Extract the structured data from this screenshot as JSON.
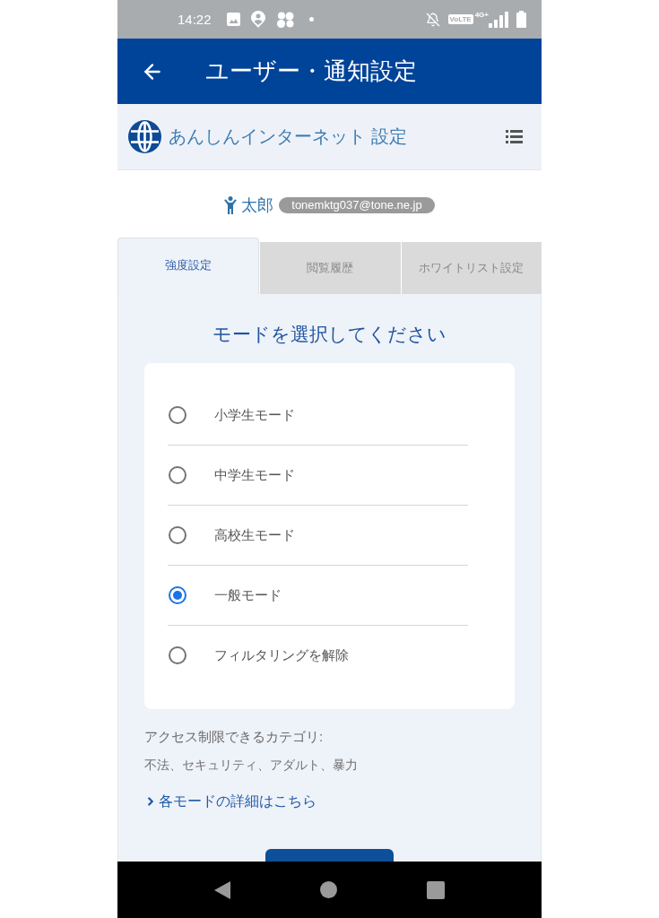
{
  "status_bar": {
    "time": "14:22",
    "volte": "VoLTE",
    "network": "4G+"
  },
  "app_bar": {
    "title": "ユーザー・通知設定"
  },
  "service_header": {
    "title": "あんしんインターネット 設定"
  },
  "user": {
    "name": "太郎",
    "email": "tonemktg037@tone.ne.jp"
  },
  "tabs": [
    {
      "label": "強度設定",
      "selected": true
    },
    {
      "label": "閲覧履歴",
      "selected": false
    },
    {
      "label": "ホワイトリスト設定",
      "selected": false
    }
  ],
  "mode_panel": {
    "heading": "モードを選択してください",
    "modes": [
      {
        "label": "小学生モード",
        "selected": false
      },
      {
        "label": "中学生モード",
        "selected": false
      },
      {
        "label": "高校生モード",
        "selected": false
      },
      {
        "label": "一般モード",
        "selected": true
      },
      {
        "label": "フィルタリングを解除",
        "selected": false
      }
    ]
  },
  "categories": {
    "label": "アクセス制限できるカテゴリ:",
    "items": "不法、セキュリティ、アダルト、暴力"
  },
  "details_link": {
    "label": "各モードの詳細はこちら"
  }
}
